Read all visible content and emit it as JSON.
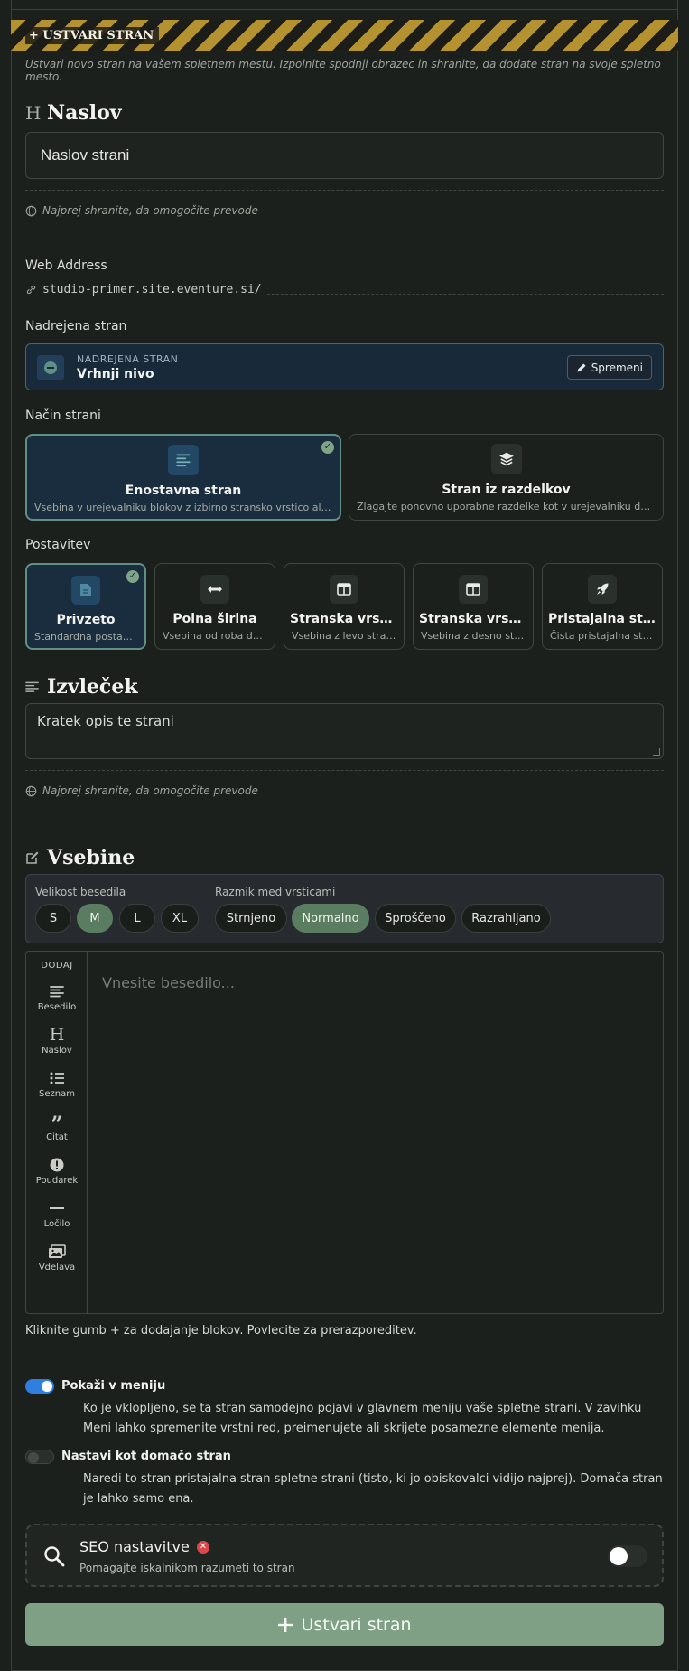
{
  "banner": {
    "label": "+ USTVARI STRAN"
  },
  "intro": "Ustvari novo stran na vašem spletnem mestu. Izpolnite spodnji obrazec in shranite, da dodate stran na svoje spletno mesto.",
  "title_section": {
    "heading": "Naslov",
    "icon": "heading-icon",
    "value": "Naslov strani",
    "hint": "Najprej shranite, da omogočite prevode"
  },
  "web_address": {
    "label": "Web Address",
    "value": "studio-primer.site.eventure.si/"
  },
  "parent": {
    "label": "Nadrejena stran",
    "caption": "NADREJENA STRAN",
    "value": "Vrhnji nivo",
    "edit_label": "Spremeni"
  },
  "page_mode": {
    "label": "Način strani",
    "options": [
      {
        "title": "Enostavna stran",
        "desc": "Vsebina v urejevalniku blokov z izbirno stransko vrstico ali pristajalno postavitvijo",
        "icon": "align-left-icon",
        "selected": true
      },
      {
        "title": "Stran iz razdelkov",
        "desc": "Zlagajte ponovno uporabne razdelke kot v urejevalniku domače strani",
        "icon": "layers-icon",
        "selected": false
      }
    ]
  },
  "layout": {
    "label": "Postavitev",
    "options": [
      {
        "title": "Privzeto",
        "desc": "Standardna postavitev",
        "icon": "file-icon",
        "selected": true
      },
      {
        "title": "Polna širina",
        "desc": "Vsebina od roba do roba",
        "icon": "arrows-horizontal-icon",
        "selected": false
      },
      {
        "title": "Stranska vrstica levo",
        "desc": "Vsebina z levo stransko vrstico",
        "icon": "columns-icon",
        "selected": false
      },
      {
        "title": "Stranska vrstica desno",
        "desc": "Vsebina z desno stransko vrstico",
        "icon": "columns-icon",
        "selected": false
      },
      {
        "title": "Pristajalna stran",
        "desc": "Čista pristajalna stran",
        "icon": "rocket-icon",
        "selected": false
      }
    ]
  },
  "excerpt": {
    "heading": "Izvleček",
    "value": "Kratek opis te strani",
    "hint": "Najprej shranite, da omogočite prevode"
  },
  "content": {
    "heading": "Vsebine",
    "font_size_label": "Velikost besedila",
    "font_sizes": [
      "S",
      "M",
      "L",
      "XL"
    ],
    "font_size_selected": "M",
    "line_spacing_label": "Razmik med vrsticami",
    "line_spacings": [
      "Strnjeno",
      "Normalno",
      "Sproščeno",
      "Razrahljano"
    ],
    "line_spacing_selected": "Normalno",
    "add_label": "DODAJ",
    "tools": [
      {
        "label": "Besedilo",
        "icon": "text-icon"
      },
      {
        "label": "Naslov",
        "icon": "heading-icon"
      },
      {
        "label": "Seznam",
        "icon": "list-icon"
      },
      {
        "label": "Citat",
        "icon": "quote-icon"
      },
      {
        "label": "Poudarek",
        "icon": "alert-icon"
      },
      {
        "label": "Ločilo",
        "icon": "divider-icon"
      },
      {
        "label": "Vdelava",
        "icon": "image-icon"
      }
    ],
    "placeholder": "Vnesite besedilo...",
    "help": "Kliknite gumb + za dodajanje blokov. Povlecite za prerazporeditev."
  },
  "show_in_menu": {
    "label": "Pokaži v meniju",
    "on": true,
    "desc": "Ko je vklopljeno, se ta stran samodejno pojavi v glavnem meniju vaše spletne strani. V zavihku Meni lahko spremenite vrstni red, preimenujete ali skrijete posamezne elemente menija."
  },
  "set_homepage": {
    "label": "Nastavi kot domačo stran",
    "on": false,
    "desc": "Naredi to stran pristajalna stran spletne strani (tisto, ki jo obiskovalci vidijo najprej). Domača stran je lahko samo ena."
  },
  "seo": {
    "title": "SEO nastavitve",
    "subtitle": "Pomagajte iskalnikom razumeti to stran",
    "on": false
  },
  "submit": {
    "label": "Ustvari stran"
  },
  "colors": {
    "accent": "#7fa085",
    "selected_card": "#1a2d3e",
    "toggle_on": "#2f7fe0",
    "banner_stripe": "#b49230"
  }
}
